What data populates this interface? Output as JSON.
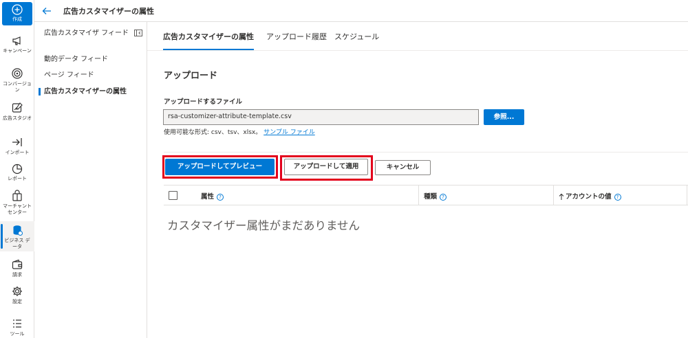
{
  "rail": {
    "create_label": "作成",
    "items": [
      {
        "label": "キャンペーン",
        "icon": "megaphone-icon"
      },
      {
        "label": "コンバージョン",
        "icon": "target-icon"
      },
      {
        "label": "広告スタジオ",
        "icon": "ad-studio-icon"
      },
      {
        "label": "インポート",
        "icon": "import-icon"
      },
      {
        "label": "レポート",
        "icon": "report-icon"
      },
      {
        "label": "マーチャント センター",
        "icon": "shopping-bag-icon"
      },
      {
        "label": "ビジネス データ",
        "icon": "database-icon"
      },
      {
        "label": "請求",
        "icon": "wallet-icon"
      },
      {
        "label": "設定",
        "icon": "gear-icon"
      },
      {
        "label": "ツール",
        "icon": "tools-icon"
      }
    ]
  },
  "header": {
    "title": "広告カスタマイザーの属性"
  },
  "subnav": {
    "items": [
      {
        "label": "広告カスタマイザ フィード"
      },
      {
        "label": "動的データ フィード"
      },
      {
        "label": "ページ フィード"
      },
      {
        "label": "広告カスタマイザーの属性"
      }
    ]
  },
  "tabs": [
    {
      "label": "広告カスタマイザーの属性"
    },
    {
      "label": "アップロード履歴"
    },
    {
      "label": "スケジュール"
    }
  ],
  "upload": {
    "title": "アップロード",
    "file_label": "アップロードするファイル",
    "file_value": "rsa-customizer-attribute-template.csv",
    "browse_label": "参照...",
    "format_note": "使用可能な形式: csv、tsv、xlsx。",
    "sample_link": "サンプル ファイル"
  },
  "actions": {
    "preview": "アップロードしてプレビュー",
    "apply": "アップロードして適用",
    "cancel": "キャンセル"
  },
  "table": {
    "columns": [
      "属性",
      "種類",
      "アカウントの値"
    ],
    "empty": "カスタマイザー属性がまだありません"
  },
  "colors": {
    "accent": "#0078d4",
    "highlight": "#e3001b"
  }
}
